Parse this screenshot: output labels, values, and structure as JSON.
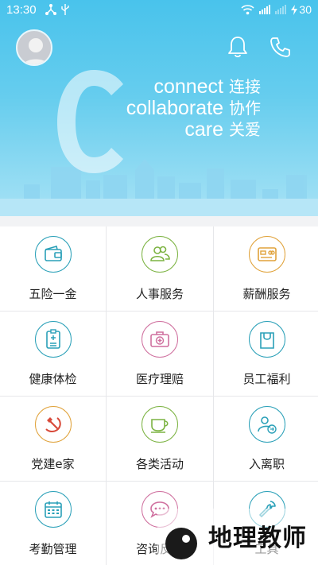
{
  "status_bar": {
    "time": "13:30",
    "battery": "30"
  },
  "banner": {
    "slogan_en": [
      "connect",
      "collaborate",
      "care"
    ],
    "slogan_cn": [
      "连接",
      "协作",
      "关爱"
    ]
  },
  "colors": {
    "banner_top": "#49c3ec",
    "banner_bottom": "#a7e2f5",
    "teal": "#2aa0b8",
    "green": "#7cb342",
    "orange": "#e0a23a",
    "pink": "#cf6f9e",
    "red": "#d84a3a"
  },
  "services": [
    {
      "id": "pension",
      "label": "五险一金",
      "icon": "wallet-icon",
      "color": "#2aa0b8"
    },
    {
      "id": "hr",
      "label": "人事服务",
      "icon": "people-icon",
      "color": "#7cb342"
    },
    {
      "id": "salary",
      "label": "薪酬服务",
      "icon": "card-icon",
      "color": "#e0a23a"
    },
    {
      "id": "checkup",
      "label": "健康体检",
      "icon": "clipboard-icon",
      "color": "#2aa0b8"
    },
    {
      "id": "claims",
      "label": "医疗理赔",
      "icon": "medical-kit-icon",
      "color": "#cf6f9e"
    },
    {
      "id": "welfare",
      "label": "员工福利",
      "icon": "shopping-bag-icon",
      "color": "#2aa0b8"
    },
    {
      "id": "party",
      "label": "党建e家",
      "icon": "hammer-sickle-icon",
      "color": "#e0a23a"
    },
    {
      "id": "activities",
      "label": "各类活动",
      "icon": "coffee-cup-icon",
      "color": "#7cb342"
    },
    {
      "id": "onboarding",
      "label": "入离职",
      "icon": "user-exchange-icon",
      "color": "#2aa0b8"
    },
    {
      "id": "attendance",
      "label": "考勤管理",
      "icon": "calendar-icon",
      "color": "#2aa0b8"
    },
    {
      "id": "feedback",
      "label": "咨询反馈",
      "icon": "chat-bubble-icon",
      "color": "#cf6f9e"
    },
    {
      "id": "tools",
      "label": "工具",
      "icon": "wrench-icon",
      "color": "#2aa0b8"
    }
  ],
  "watermark": {
    "text": "地理教师"
  }
}
